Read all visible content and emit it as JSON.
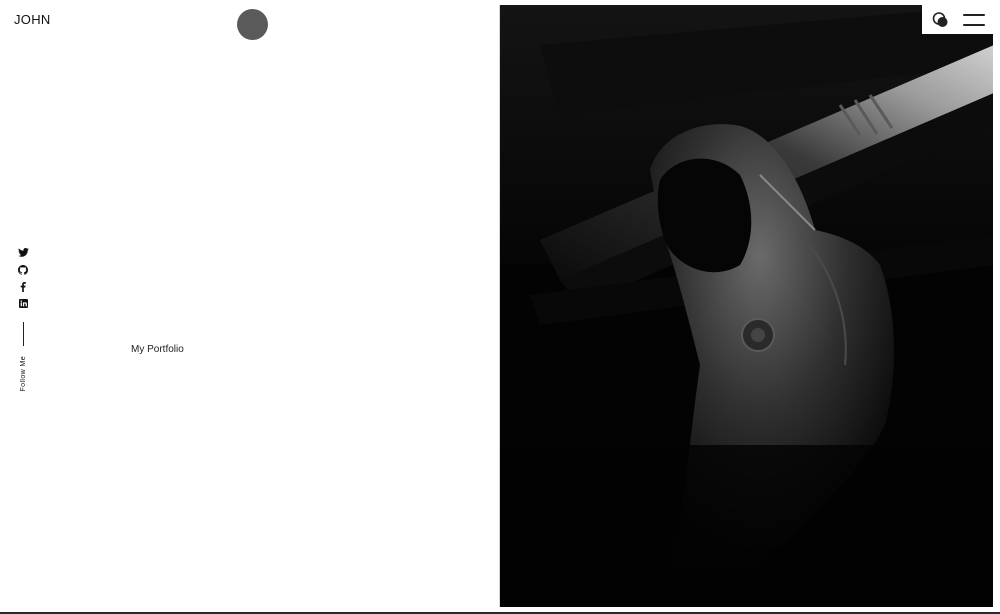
{
  "header": {
    "brand": "JOHN"
  },
  "socials": {
    "items": [
      {
        "icon": "twitter-icon",
        "name": "Twitter"
      },
      {
        "icon": "github-icon",
        "name": "GitHub"
      },
      {
        "icon": "facebook-icon",
        "name": "Facebook"
      },
      {
        "icon": "linkedin-icon",
        "name": "LinkedIn"
      }
    ],
    "follow_label": "Follow Me"
  },
  "main": {
    "subtitle": "My Portfolio"
  },
  "controls": {
    "theme_toggle_icon": "theme-toggle-icon",
    "menu_icon": "hamburger-menu-icon"
  },
  "colors": {
    "background": "#ffffff",
    "text": "#111111",
    "cursor_dot": "#5a5a5a",
    "hero_background": "#000000"
  }
}
